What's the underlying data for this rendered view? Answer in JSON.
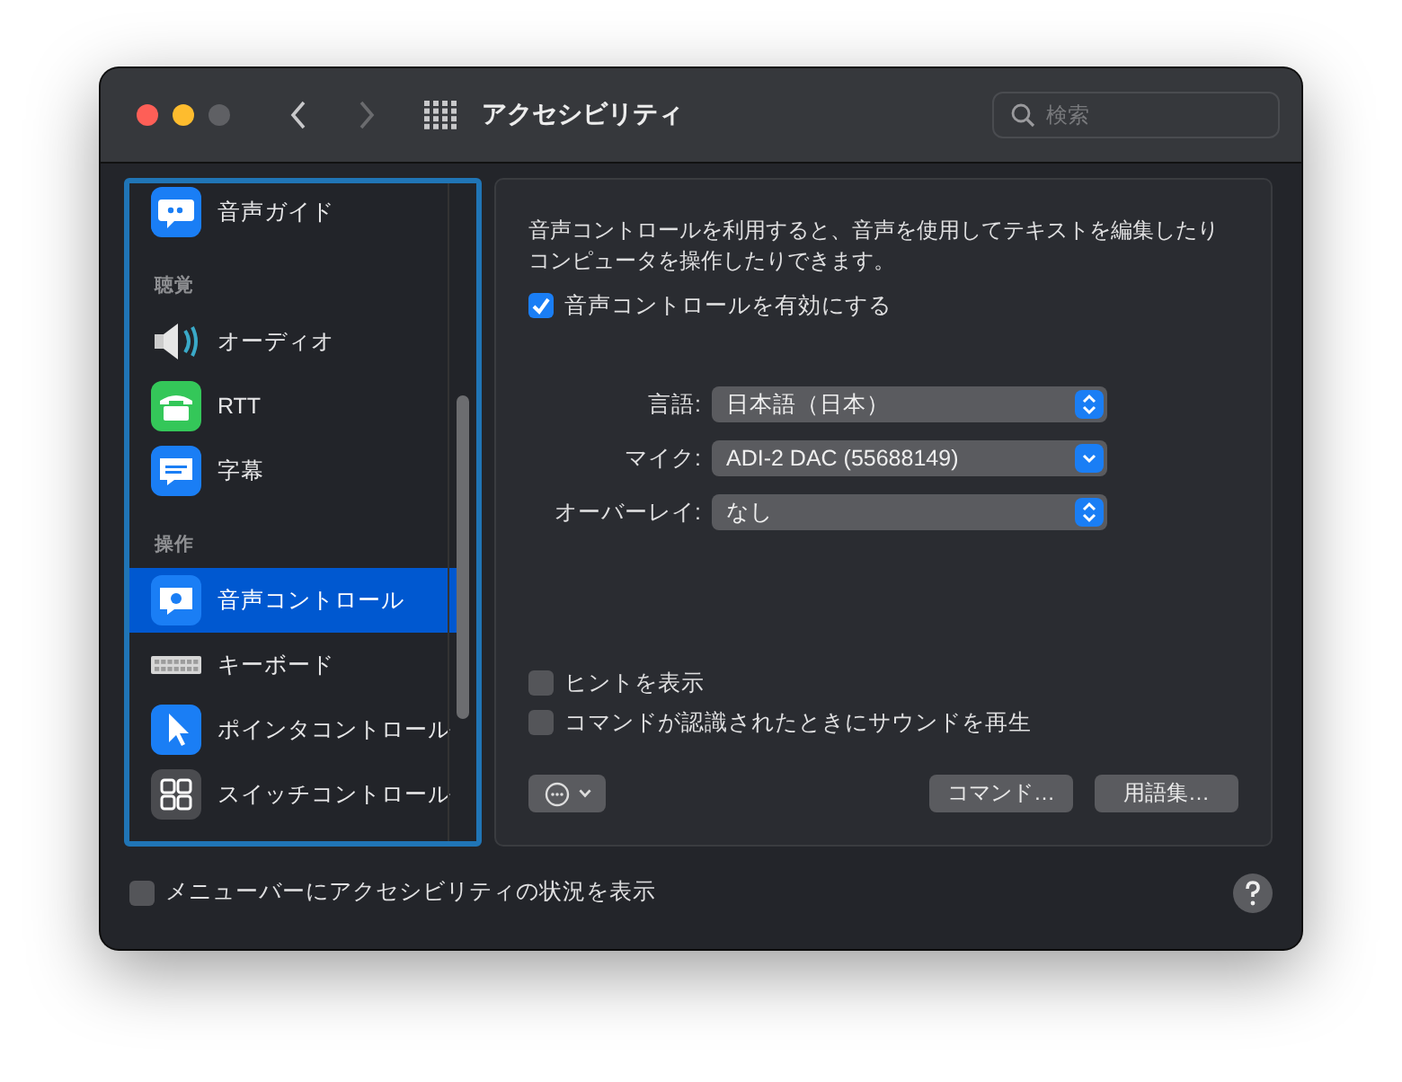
{
  "window": {
    "title": "アクセシビリティ"
  },
  "search": {
    "placeholder": "検索"
  },
  "sidebar": {
    "items": [
      {
        "kind": "item",
        "label": "音声ガイド",
        "selected": false
      },
      {
        "kind": "header",
        "label": "聴覚"
      },
      {
        "kind": "item",
        "label": "オーディオ",
        "selected": false
      },
      {
        "kind": "item",
        "label": "RTT",
        "selected": false
      },
      {
        "kind": "item",
        "label": "字幕",
        "selected": false
      },
      {
        "kind": "header",
        "label": "操作"
      },
      {
        "kind": "item",
        "label": "音声コントロール",
        "selected": true
      },
      {
        "kind": "item",
        "label": "キーボード",
        "selected": false
      },
      {
        "kind": "item",
        "label": "ポインタコントロール",
        "selected": false
      },
      {
        "kind": "item",
        "label": "スイッチコントロール",
        "selected": false
      }
    ]
  },
  "panel": {
    "description": "音声コントロールを利用すると、音声を使用してテキストを編集したりコンピュータを操作したりできます。",
    "enable_checkbox": {
      "label": "音声コントロールを有効にする",
      "checked": true
    },
    "popups": [
      {
        "label": "言語:",
        "value": "日本語（日本）",
        "kind": "stepper"
      },
      {
        "label": "マイク:",
        "value": "ADI-2 DAC (55688149)",
        "kind": "dropdown"
      },
      {
        "label": "オーバーレイ:",
        "value": "なし",
        "kind": "stepper"
      }
    ],
    "checkboxes": [
      {
        "label": "ヒントを表示",
        "checked": false
      },
      {
        "label": "コマンドが認識されたときにサウンドを再生",
        "checked": false
      }
    ],
    "buttons": [
      "コマンド…",
      "用語集…"
    ]
  },
  "footer": {
    "checkbox": {
      "label": "メニューバーにアクセシビリティの状況を表示",
      "checked": false
    }
  }
}
